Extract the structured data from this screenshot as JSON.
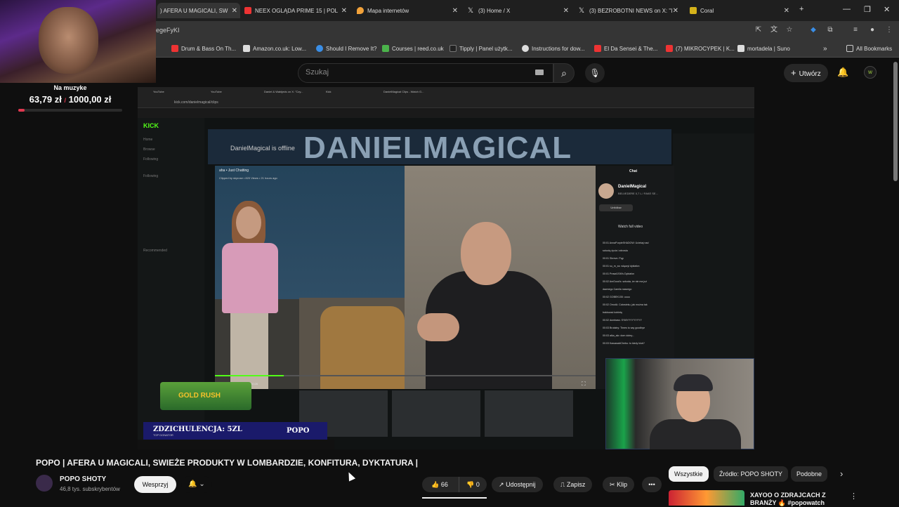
{
  "browser": {
    "tabs": [
      {
        "label": ") AFERA U MAGICALI, SW",
        "active": true,
        "fav": "#e33"
      },
      {
        "label": "NEEX OGLĄDA PRIME 15 | POL",
        "fav": "#e33"
      },
      {
        "label": "Mapa internetów",
        "fav": "#f2a23a"
      },
      {
        "label": "(3) Home / X",
        "fav": "#ddd"
      },
      {
        "label": "(3) BEZROBOTNI NEWS on X: \"I",
        "fav": "#ddd"
      },
      {
        "label": "Coral",
        "fav": "#d4b21a"
      }
    ],
    "url": "egeFyKI",
    "bookmarks": [
      {
        "label": "Drum & Bass On Th...",
        "color": "#e33"
      },
      {
        "label": "Amazon.co.uk: Low...",
        "color": "#ddd"
      },
      {
        "label": "Should I Remove It?",
        "color": "#3a8ee6"
      },
      {
        "label": "Courses | reed.co.uk",
        "color": "#4bb34b"
      },
      {
        "label": "Tipply | Panel użytk...",
        "color": "#222"
      },
      {
        "label": "Instructions for dow...",
        "color": "#ddd"
      },
      {
        "label": "El Da Sensei & The...",
        "color": "#e33"
      },
      {
        "label": "(7) MIKROCYPEK | K...",
        "color": "#e33"
      },
      {
        "label": "mortadela | Suno",
        "color": "#ddd"
      }
    ],
    "all_bookmarks": "All Bookmarks"
  },
  "donation": {
    "label": "Na muzyke",
    "current": "63,79 zł",
    "separator": "/",
    "goal": "1000,00 zł",
    "progress": 0.0638
  },
  "youtube": {
    "search_placeholder": "Szukaj",
    "create_label": "Utwórz",
    "avatar_letter": "w"
  },
  "player": {
    "inner_url": "kick.com/danielmagical/clips",
    "inner_tabs": [
      "YouTube",
      "YouTube",
      "Daniel & Wabijeds on X: \"Czy...",
      "Kick",
      "DanielMagical Clips - Watch G..."
    ],
    "kick_logo": "KICK",
    "sidebar_items": [
      "Home",
      "Browse",
      "Following",
      "Following",
      "Recommended"
    ],
    "banner_text": "DANIELMAGICAL",
    "offline_text": "DanielMagical is offline",
    "clip": {
      "header": "aha • Just Chatting",
      "sub": "Clipped by skyrose • 820 Views • 21 hours ago",
      "time": "0:05 / 00:26",
      "progress": 0.18
    },
    "clip_chat": {
      "title": "Chat",
      "streamer": "DanielMagical",
      "streamer_sub": "BELVEDERE 0,7 L / FAKE SE...",
      "unfollow": "Unfollow",
      "watch_full": "Watch full video",
      "messages": [
        "00:01 AnnaPurpleSHADOW: Uciekaj nad",
        "szkodą życia i zdrowia",
        "00:01 Shrevn: Pąp",
        "00:01 su_m_ss: włączył dyktafon",
        "00:01 Prawd1SM's Dyktafon",
        "00:02 AmGood's: szkoda, że nie ma już",
        "dawnego Camila naszego",
        "00:02 GOBEK155: uuuu",
        "00:02 OmotA: Człowieku, jak można tak",
        "traktować kobietę",
        "00:02 dumbass: SYMYYYYYYYYY",
        "00:03 Brutalny: Times to say goodbye",
        "00:03 alka_alo: dom dobry...",
        "00:03 KawasakiChebu: to kiedy klub?"
      ]
    },
    "gold_rush": "GOLD RUSH",
    "alert_main": "ZDZICHULENCJA: 5ZL",
    "alert_sub": "TOP DONATOR",
    "alert_name": "POPO"
  },
  "video": {
    "title": "POPO | AFERA U MAGICALI, SWIEŻE PRODUKTY W LOMBARDZIE, KONFITURA, DYKTATURA |",
    "channel": "POPO SHOTY",
    "subscribers": "46,8 tys. subskrybentów",
    "support_label": "Wesprzyj",
    "likes": "66",
    "dislikes": "0",
    "share_label": "Udostępnij",
    "save_label": "Zapisz",
    "clip_label": "Klip"
  },
  "recommendations": {
    "chips": [
      "Wszystkie",
      "Źródło: POPO SHOTY",
      "Podobne"
    ],
    "first_title": "XAYOO O ZDRAJCACH Z BRANŻY 🔥 #popowatch"
  }
}
